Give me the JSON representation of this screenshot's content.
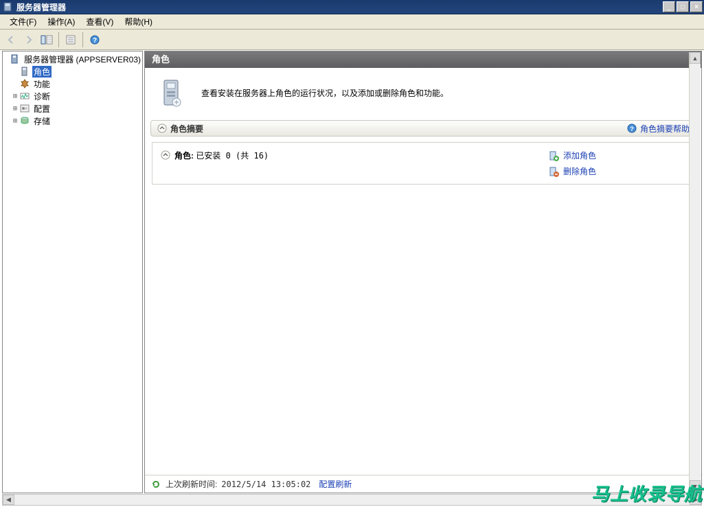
{
  "window": {
    "title": "服务器管理器",
    "minimize": "_",
    "maximize": "□",
    "close": "×"
  },
  "menubar": {
    "file": "文件(F)",
    "action": "操作(A)",
    "view": "查看(V)",
    "help": "帮助(H)"
  },
  "toolbar": {
    "back": "back",
    "forward": "forward",
    "up": "up",
    "props": "props",
    "help": "help"
  },
  "tree": {
    "root": "服务器管理器 (APPSERVER03)",
    "roles": "角色",
    "features": "功能",
    "diagnostics": "诊断",
    "configuration": "配置",
    "storage": "存储"
  },
  "content": {
    "header": "角色",
    "intro": "查看安装在服务器上角色的运行状况，以及添加或删除角色和功能。",
    "section_title": "角色摘要",
    "section_help": "角色摘要帮助",
    "roles_label": "角色:",
    "roles_status": "已安装 0 (共 16)",
    "add_role": "添加角色",
    "remove_role": "删除角色",
    "footer_label": "上次刷新时间:",
    "footer_time": "2012/5/14 13:05:02",
    "footer_config": "配置刷新"
  },
  "watermark": "马上收录导航"
}
